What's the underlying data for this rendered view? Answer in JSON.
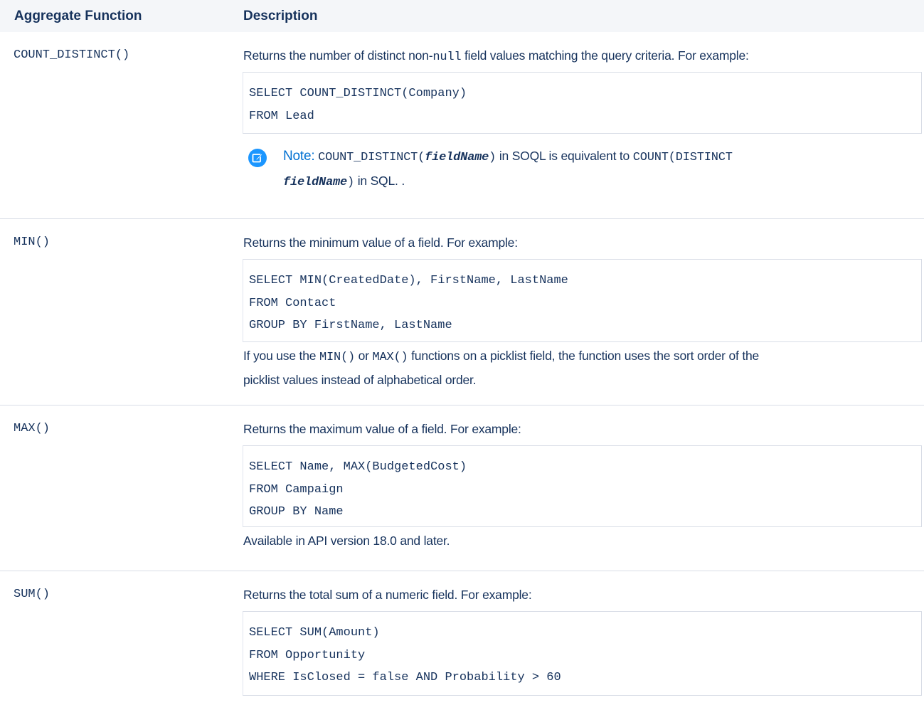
{
  "header": {
    "col_function": "Aggregate Function",
    "col_description": "Description"
  },
  "rows": [
    {
      "function": "COUNT_DISTINCT()",
      "intro": "Returns the number of distinct non-",
      "intro_code": "null",
      "intro_tail": " field values matching the query criteria. For example:",
      "code": [
        "SELECT COUNT_DISTINCT(Company)",
        "FROM Lead"
      ],
      "note": {
        "label": "Note:",
        "p1_code": "COUNT_DISTINCT(",
        "p1_arg": "fieldName",
        "p1_close": ")",
        "p1_text": " in SOQL is equivalent to ",
        "p1_code2": "COUNT(DISTINCT",
        "p2_arg": "fieldName",
        "p2_close": ")",
        "p2_text": " in SQL. ."
      }
    },
    {
      "function": "MIN()",
      "intro": "Returns the minimum value of a field. For example:",
      "code": [
        "SELECT MIN(CreatedDate), FirstName, LastName",
        "FROM Contact",
        "GROUP BY FirstName, LastName"
      ],
      "after_1a": "If you use the ",
      "after_1_code1": "MIN()",
      "after_1b": " or ",
      "after_1_code2": "MAX()",
      "after_1c": " functions on a picklist field, the function uses the sort order of the",
      "after_2": "picklist values instead of alphabetical order."
    },
    {
      "function": "MAX()",
      "intro": "Returns the maximum value of a field. For example:",
      "code": [
        "SELECT Name, MAX(BudgetedCost)",
        "FROM Campaign",
        "GROUP BY Name"
      ],
      "after": "Available in API version 18.0 and later."
    },
    {
      "function": "SUM()",
      "intro": "Returns the total sum of a numeric field. For example:",
      "code": [
        "SELECT SUM(Amount)",
        "FROM Opportunity",
        "WHERE IsClosed = false AND Probability > 60"
      ]
    }
  ],
  "colors": {
    "text": "#16325c",
    "header_bg": "#f4f6f9",
    "border": "#d8dde6",
    "note_accent": "#0070d2",
    "note_icon": "#1b96ff"
  },
  "icons": {
    "note": "edit-note-icon"
  }
}
